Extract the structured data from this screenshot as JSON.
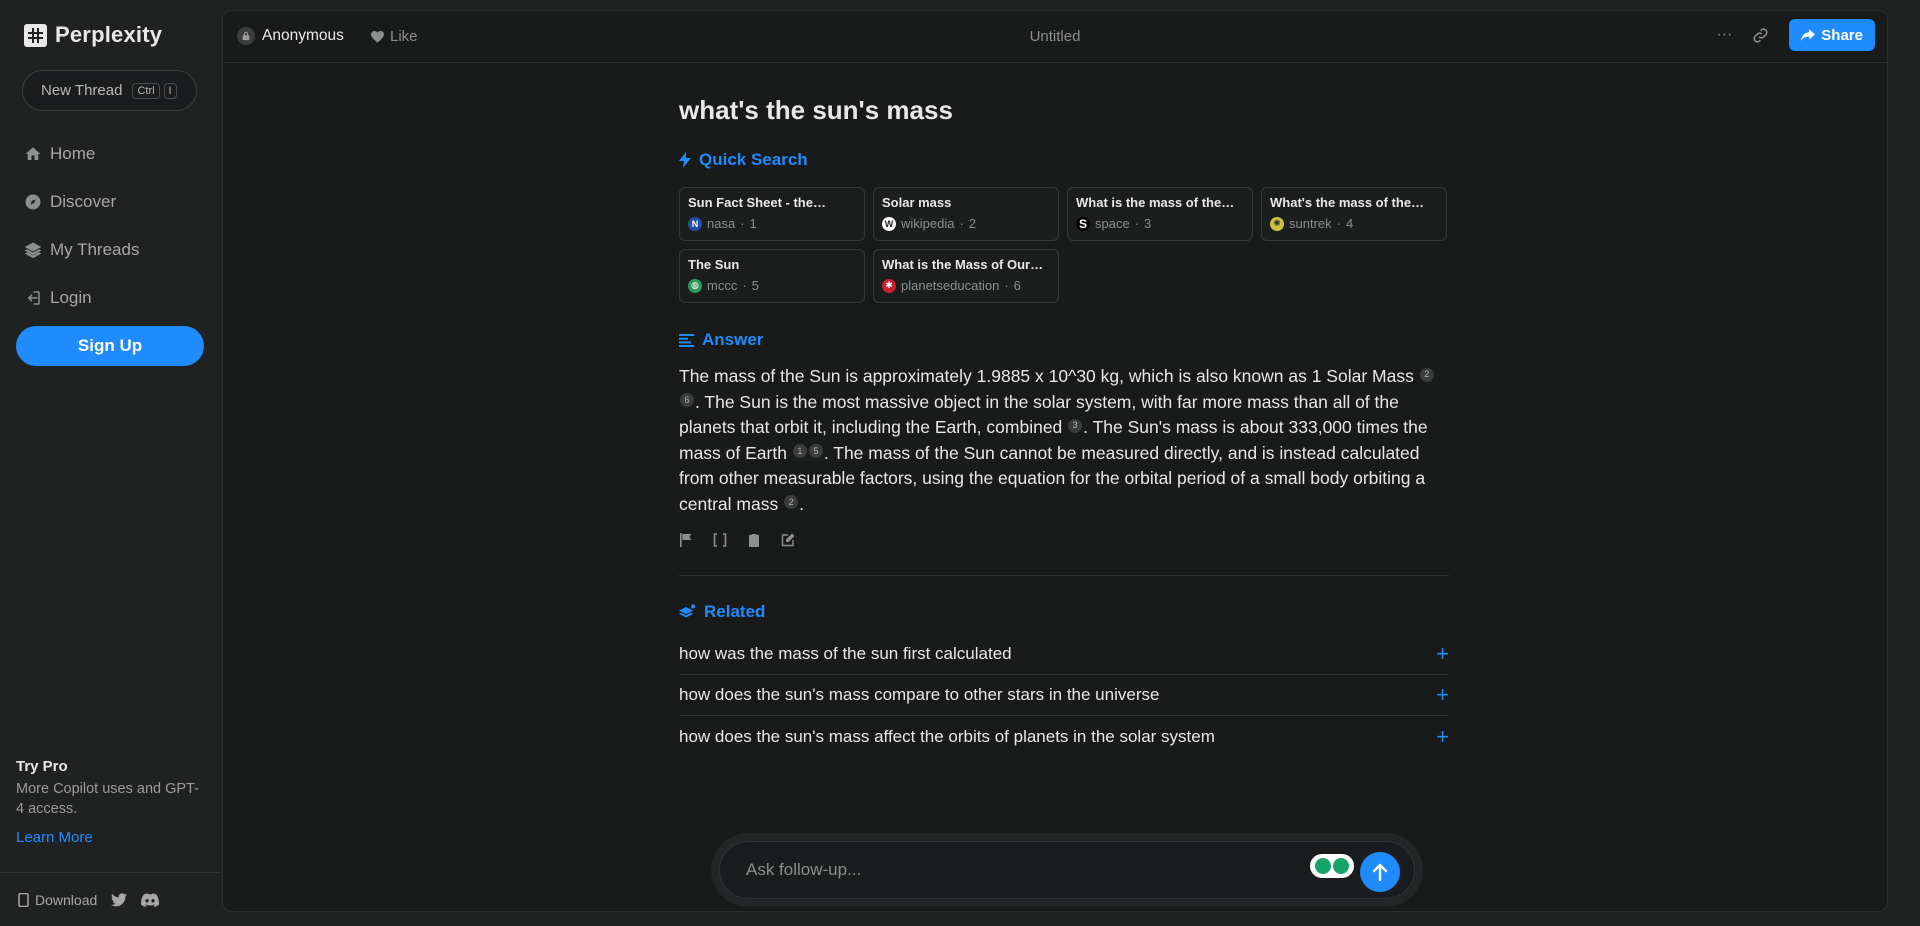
{
  "sidebar": {
    "brand": "Perplexity",
    "new_thread": {
      "label": "New Thread",
      "kbd1": "Ctrl",
      "kbd2": "I"
    },
    "nav": [
      {
        "label": "Home",
        "icon": "home-icon"
      },
      {
        "label": "Discover",
        "icon": "compass-icon"
      },
      {
        "label": "My Threads",
        "icon": "layers-icon"
      },
      {
        "label": "Login",
        "icon": "login-icon"
      }
    ],
    "signup": "Sign Up",
    "try_pro": {
      "title": "Try Pro",
      "desc": "More Copilot uses and GPT-4 access.",
      "link": "Learn More"
    },
    "footer": {
      "download": "Download"
    }
  },
  "topbar": {
    "user": "Anonymous",
    "like": "Like",
    "title": "Untitled",
    "share": "Share"
  },
  "thread": {
    "query": "what's the sun's mass",
    "quick_search_label": "Quick Search",
    "sources": [
      {
        "title": "Sun Fact Sheet - the…",
        "site": "nasa",
        "num": "1",
        "fav_color": "#1b4fa8",
        "fav_text": "N"
      },
      {
        "title": "Solar mass",
        "site": "wikipedia",
        "num": "2",
        "fav_color": "#ffffff",
        "fav_text": "W"
      },
      {
        "title": "What is the mass of the…",
        "site": "space",
        "num": "3",
        "fav_color": "#000000",
        "fav_text": "S"
      },
      {
        "title": "What's the mass of the…",
        "site": "suntrek",
        "num": "4",
        "fav_color": "#c9c23a",
        "fav_text": "✺"
      },
      {
        "title": "The Sun",
        "site": "mccc",
        "num": "5",
        "fav_color": "#2e9a5a",
        "fav_text": "◍"
      },
      {
        "title": "What is the Mass of Our…",
        "site": "planetseducation",
        "num": "6",
        "fav_color": "#c8202c",
        "fav_text": "✱"
      }
    ],
    "answer_label": "Answer",
    "answer": {
      "s1": "The mass of the Sun is approximately 1.9885 x 10^30 kg, which is also known as 1 Solar Mass",
      "c1a": "2",
      "c1b": "6",
      "s2": ". The Sun is the most massive object in the solar system, with far more mass than all of the planets that orbit it, including the Earth, combined",
      "c2": "3",
      "s3": ". The Sun's mass is about 333,000 times the mass of Earth",
      "c3a": "1",
      "c3b": "5",
      "s4": ". The mass of the Sun cannot be measured directly, and is instead calculated from other measurable factors, using the equation for the orbital period of a small body orbiting a central mass",
      "c4": "2",
      "s5": "."
    },
    "related_label": "Related",
    "related": [
      "how was the mass of the sun first calculated",
      "how does the sun's mass compare to other stars in the universe",
      "how does the sun's mass affect the orbits of planets in the solar system"
    ],
    "followup_placeholder": "Ask follow-up..."
  },
  "colors": {
    "accent": "#1f8bfd",
    "bg": "#191a1a",
    "sidebar": "#202222"
  }
}
